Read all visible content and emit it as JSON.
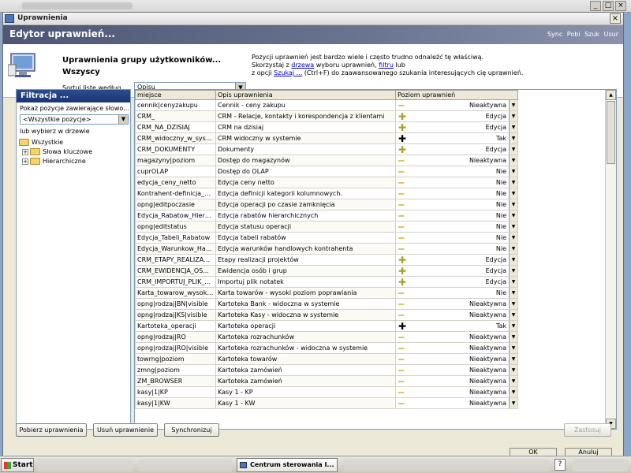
{
  "window": {
    "title": "Uprawnienia",
    "close_glyph": "×"
  },
  "header": {
    "title": "Edytor uprawnień...",
    "links": [
      "Sync",
      "Pobi",
      "Szuk",
      "Usur"
    ]
  },
  "info": {
    "group_label": "Uprawnienia grupy użytkowników...",
    "group_name": "Wszyscy",
    "sort_label": "Sortuj listę według...",
    "sort_value": "Opisu",
    "help_line1": "Pozycji uprawnień jest bardzo wiele i często trudno odnaleźć tę właściwą.",
    "help_line2_a": "Skorzystaj z ",
    "help_link1": "drzewa",
    "help_line2_b": " wyboru uprawnień, ",
    "help_link2": "filtru",
    "help_line2_c": " lub",
    "help_line3_a": "z opcji ",
    "help_link3": "Szukaj ...",
    "help_line3_b": " (Ctrl+F) do zaawansowanego szukania interesujących cię uprawnień."
  },
  "filter": {
    "title": "Filtracja ...",
    "label1": "Pokaż pozycje zawierające słowo...",
    "select_value": "<Wszystkie pozycje>",
    "label2": "lub wybierz w drzewie",
    "tree": [
      {
        "label": "Wszystkie",
        "level": 0,
        "expander": ""
      },
      {
        "label": "Słowa kluczowe",
        "level": 1,
        "expander": "+"
      },
      {
        "label": "Hierarchiczne",
        "level": 1,
        "expander": "+"
      }
    ]
  },
  "grid": {
    "columns": [
      "miejsce",
      "Opis uprawnienia",
      "Poziom uprawnień"
    ],
    "rows": [
      {
        "miejsce": "cennik|cenyzakupu",
        "opis": "Cennik - ceny zakupu",
        "symbol": "minus",
        "poziom": "Nieaktywna"
      },
      {
        "miejsce": "CRM_",
        "opis": "CRM - Relacje, kontakty i korespondencja z klientami",
        "symbol": "plus",
        "poziom": "Edycja"
      },
      {
        "miejsce": "CRM_NA_DZISIAJ",
        "opis": "CRM na dzisiaj",
        "symbol": "plus",
        "poziom": "Edycja"
      },
      {
        "miejsce": "CRM_widoczny_w_syst...",
        "opis": "CRM widoczny w systemie",
        "symbol": "plus-black",
        "poziom": "Tak"
      },
      {
        "miejsce": "CRM_DOKUMENTY",
        "opis": "Dokumenty",
        "symbol": "plus",
        "poziom": "Edycja"
      },
      {
        "miejsce": "magazyny|poziom",
        "opis": "Dostęp do magazynów",
        "symbol": "minus",
        "poziom": "Nieaktywna"
      },
      {
        "miejsce": "cuprOLAP",
        "opis": "Dostęp do OLAP",
        "symbol": "minus",
        "poziom": "Nie"
      },
      {
        "miejsce": "edycja_ceny_netto",
        "opis": "Edycja ceny netto",
        "symbol": "minus",
        "poziom": "Nie"
      },
      {
        "miejsce": "Kontrahent-definicja_k...",
        "opis": "Edycja definicji kategorii kolumnowych.",
        "symbol": "minus",
        "poziom": "Nie"
      },
      {
        "miejsce": "opng|editpoczasie",
        "opis": "Edycja operacji po czasie zamknięcia",
        "symbol": "minus",
        "poziom": "Nie"
      },
      {
        "miejsce": "Edycja_Rabatow_Hiera...",
        "opis": "Edycja rabatów hierarchicznych",
        "symbol": "minus",
        "poziom": "Nie"
      },
      {
        "miejsce": "opng|editstatus",
        "opis": "Edycja statusu operacji",
        "symbol": "minus",
        "poziom": "Nie"
      },
      {
        "miejsce": "Edycja_Tabeli_Rabatow",
        "opis": "Edycja tabeli rabatów",
        "symbol": "minus",
        "poziom": "Nie"
      },
      {
        "miejsce": "Edycja_Warunkow_Han...",
        "opis": "Edycja warunków handlowych kontrahenta",
        "symbol": "minus",
        "poziom": "Nie"
      },
      {
        "miejsce": "CRM_ETAPY_REALIZAC...",
        "opis": "Etapy realizacji projektów",
        "symbol": "plus",
        "poziom": "Edycja"
      },
      {
        "miejsce": "CRM_EWIDENCJA_OS...",
        "opis": "Ewidencja osób i grup",
        "symbol": "plus",
        "poziom": "Edycja"
      },
      {
        "miejsce": "CRM_IMPORTUJ_PLIK_...",
        "opis": "Importuj plik notatek",
        "symbol": "plus",
        "poziom": "Edycja"
      },
      {
        "miejsce": "Karta_towarow_wysoki...",
        "opis": "Karta towarów - wysoki poziom poprawiania",
        "symbol": "minus",
        "poziom": "Nie"
      },
      {
        "miejsce": "opng|rodzaj|BN|visible",
        "opis": "Kartoteka Bank - widoczna w systemie",
        "symbol": "minus",
        "poziom": "Nieaktywna"
      },
      {
        "miejsce": "opng|rodzaj|KS|visible",
        "opis": "Kartoteka Kasy - widoczna w systemie",
        "symbol": "minus",
        "poziom": "Nieaktywna"
      },
      {
        "miejsce": "Kartoteka_operacji",
        "opis": "Kartoteka operacji",
        "symbol": "plus-black",
        "poziom": "Tak"
      },
      {
        "miejsce": "opng|rodzaj|RO",
        "opis": "Kartoteka rozrachunków",
        "symbol": "minus",
        "poziom": "Nieaktywna"
      },
      {
        "miejsce": "opng|rodzaj|RO|visible",
        "opis": "Kartoteka rozrachunków - widoczna w systemie",
        "symbol": "minus",
        "poziom": "Nieaktywna"
      },
      {
        "miejsce": "towrng|poziom",
        "opis": "Kartoteka towarów",
        "symbol": "minus",
        "poziom": "Nieaktywna"
      },
      {
        "miejsce": "zmng|poziom",
        "opis": "Kartoteka zamówień",
        "symbol": "minus",
        "poziom": "Nieaktywna"
      },
      {
        "miejsce": "ZM_BROWSER",
        "opis": "Kartoteka zamówień",
        "symbol": "minus",
        "poziom": "Nieaktywna"
      },
      {
        "miejsce": "kasy|1|KP",
        "opis": "Kasy 1 - KP",
        "symbol": "minus",
        "poziom": "Nieaktywna"
      },
      {
        "miejsce": "kasy|1|KW",
        "opis": "Kasy 1 - KW",
        "symbol": "minus",
        "poziom": "Nieaktywna"
      }
    ]
  },
  "buttons": {
    "fetch": "Pobierz uprawnienia",
    "remove": "Usuń uprawnienie",
    "sync": "Synchronizuj",
    "apply": "Zastosuj",
    "ok": "OK",
    "cancel": "Anuluj"
  },
  "taskbar": {
    "start": "Start",
    "task_item": "Centrum sterowania I...",
    "help": "?"
  },
  "colors": {
    "header_band": "#4d5775",
    "filter_head": "#1a3575",
    "plus_symbol": "#a9a02a",
    "minus_symbol": "#d6c860"
  }
}
